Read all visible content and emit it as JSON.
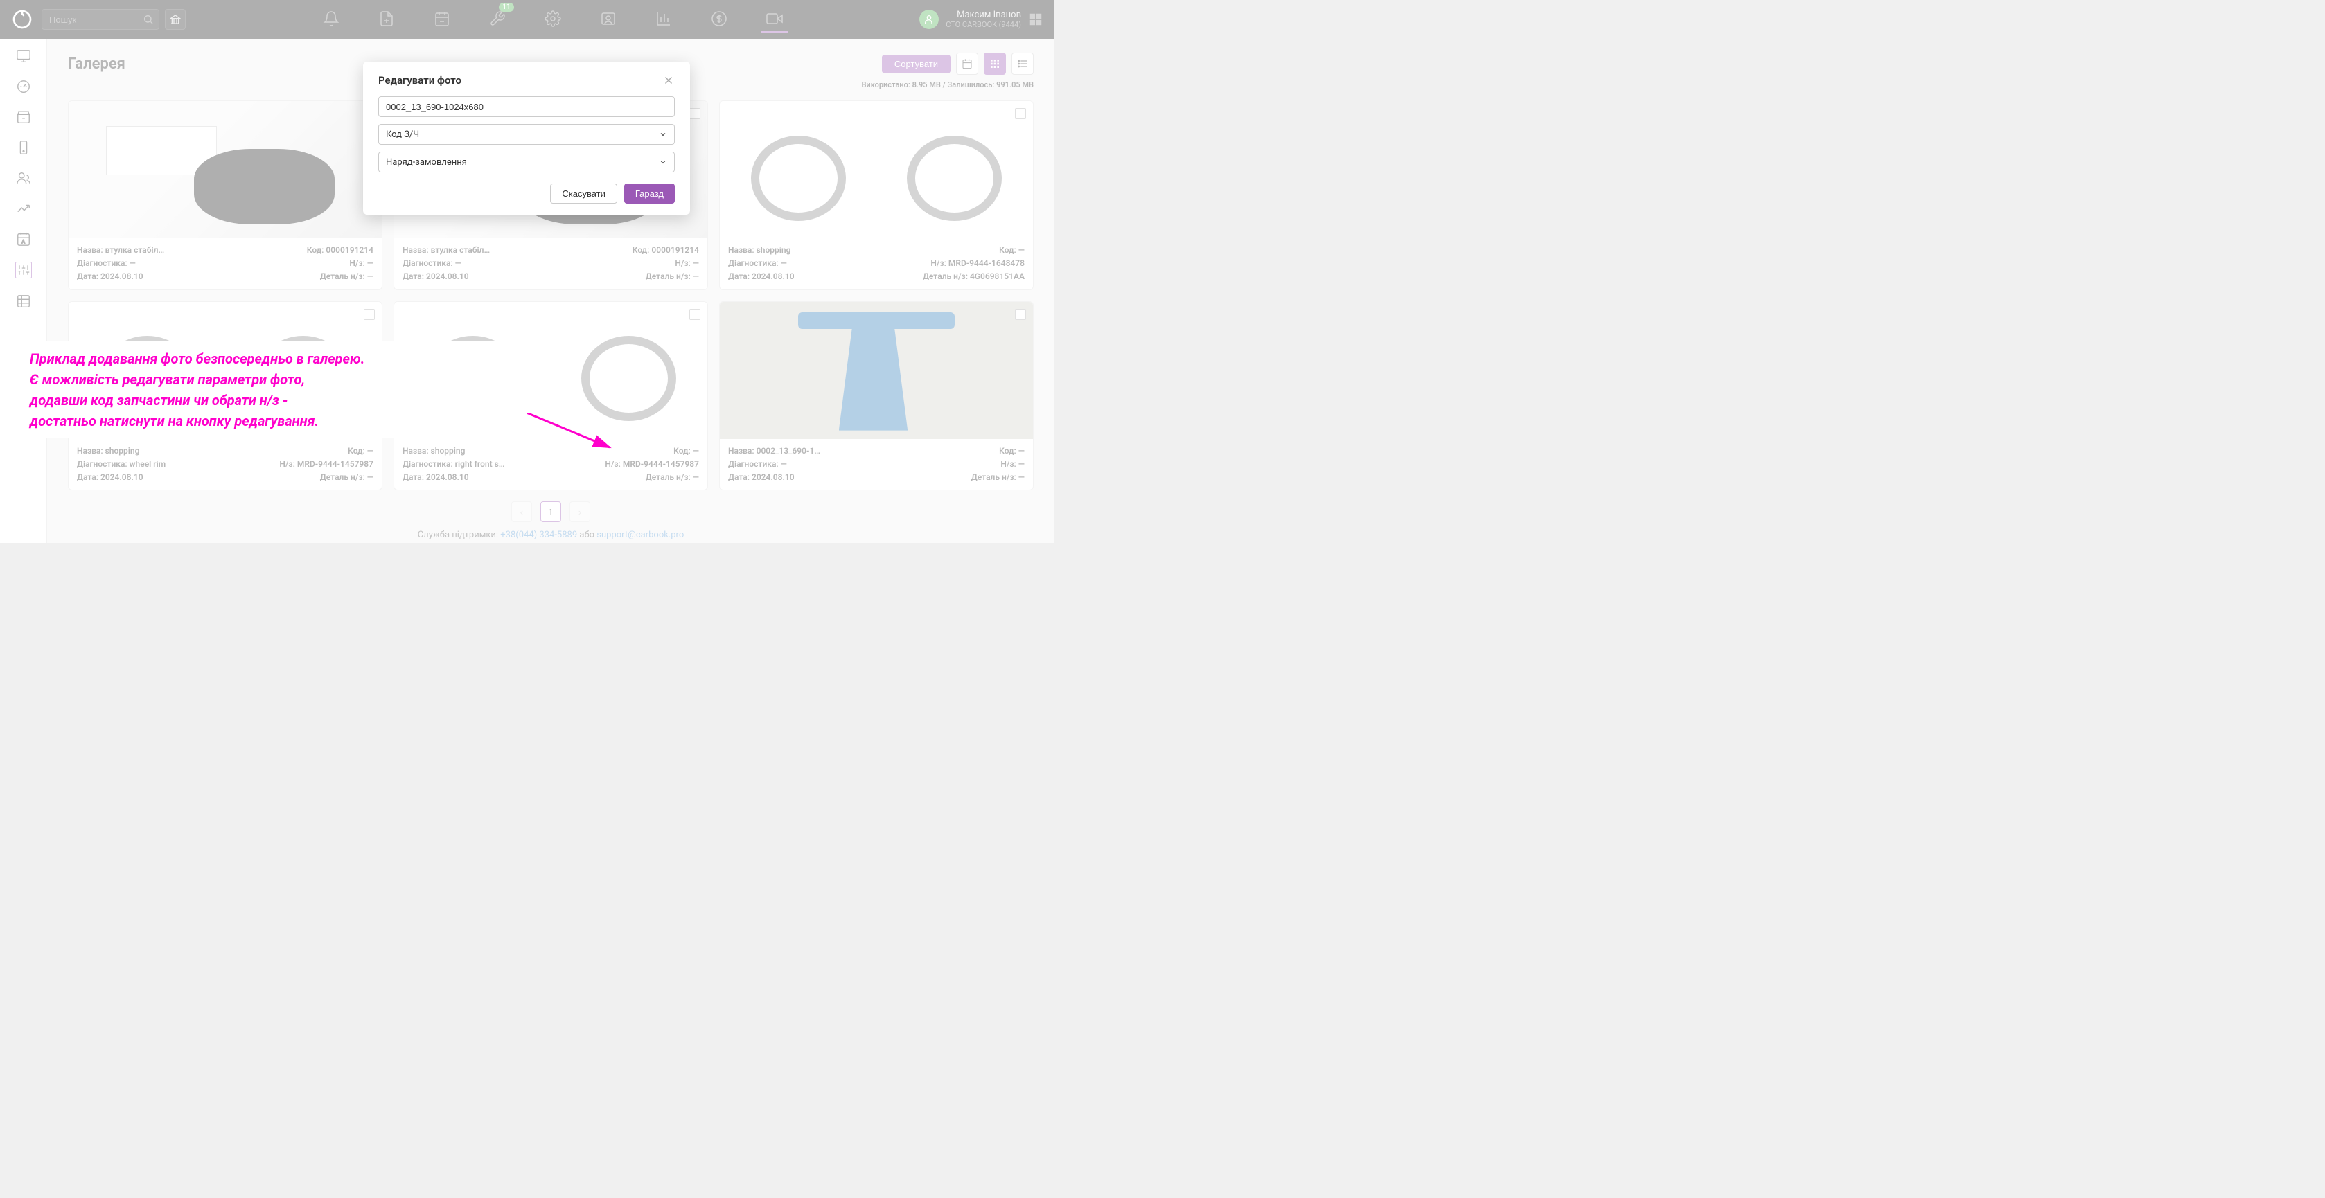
{
  "search": {
    "placeholder": "Пошук"
  },
  "badge_count": "11",
  "user": {
    "name": "Максим Іванов",
    "company": "СТО CARBOOK (9444)"
  },
  "page_title": "Галерея",
  "sort_label": "Сортувати",
  "storage": "Використано: 8.95 МВ / Залишилось: 991.05 МВ",
  "cards": [
    {
      "name": "Назва: втулка стабіл…",
      "diag": "Діагностика: —",
      "date": "Дата: 2024.08.10",
      "code": "Код: 0000191214",
      "hz": "Н/з: —",
      "det": "Деталь н/з: —",
      "img": "nissan-part"
    },
    {
      "name": "Назва: втулка стабіл…",
      "diag": "Діагностика: —",
      "date": "Дата: 2024.08.10",
      "code": "Код: 0000191214",
      "hz": "Н/з: —",
      "det": "Деталь н/з: —",
      "img": "nissan-part"
    },
    {
      "name": "Назва: shopping",
      "diag": "Діагностика: —",
      "date": "Дата: 2024.08.10",
      "code": "Код: —",
      "hz": "Н/з: MRD-9444-1648478",
      "det": "Деталь н/з: 4G0698151AA",
      "img": "brake-kit"
    },
    {
      "name": "Назва: shopping",
      "diag": "Діагностика: wheel rim",
      "date": "Дата: 2024.08.10",
      "code": "Код: —",
      "hz": "Н/з: MRD-9444-1457987",
      "det": "Деталь н/з: —",
      "img": "brake-kit"
    },
    {
      "name": "Назва: shopping",
      "diag": "Діагностика: right front s…",
      "date": "Дата: 2024.08.10",
      "code": "Код: —",
      "hz": "Н/з: MRD-9444-1457987",
      "det": "Деталь н/з: —",
      "img": "brake-kit"
    },
    {
      "name": "Назва: 0002_13_690-1…",
      "diag": "Діагностика: —",
      "date": "Дата: 2024.08.10",
      "code": "Код: —",
      "hz": "Н/з: —",
      "det": "Деталь н/з: —",
      "img": "blue-part"
    }
  ],
  "pagination": {
    "current": "1"
  },
  "footer": {
    "support": "Служба підтримки:",
    "phone": "+38(044) 334-5889",
    "or": "або",
    "email": "support@carbook.pro"
  },
  "modal": {
    "title": "Редагувати фото",
    "filename": "0002_13_690-1024x680",
    "code_placeholder": "Код З/Ч",
    "order_placeholder": "Наряд-замовлення",
    "cancel": "Скасувати",
    "ok": "Гаразд"
  },
  "annotation": {
    "l1": "Приклад додавання фото безпосередньо в галерею.",
    "l2": "Є можливість редагувати параметри фото,",
    "l3": "додавши код запчастини чи обрати н/з -",
    "l4": "достатньо натиснути на кнопку редагування."
  }
}
